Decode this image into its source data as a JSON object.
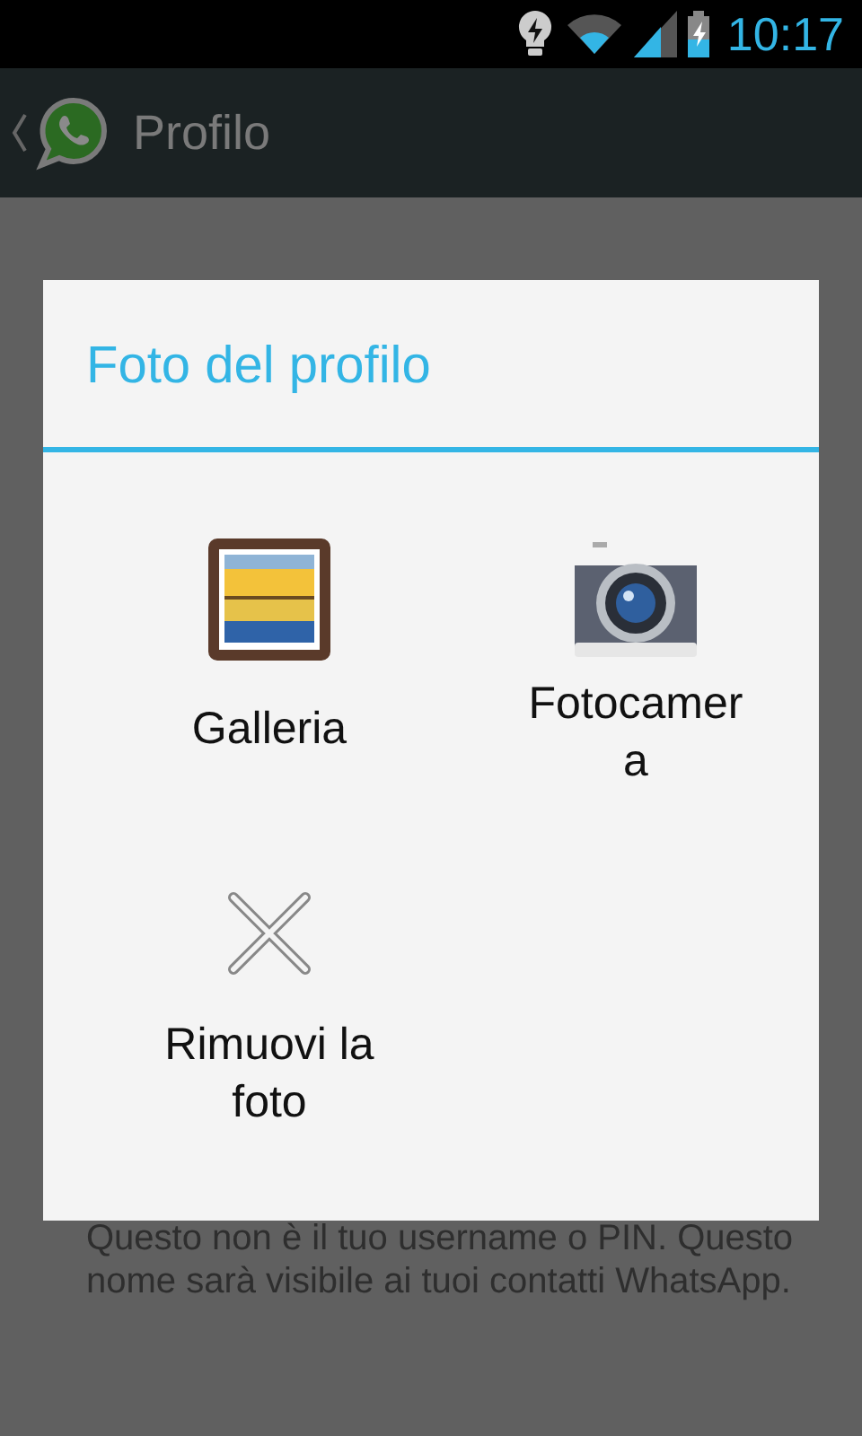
{
  "status_bar": {
    "time": "10:17"
  },
  "action_bar": {
    "title": "Profilo"
  },
  "background": {
    "help_text": "Questo non è il tuo username o PIN. Questo nome sarà visibile ai tuoi contatti WhatsApp."
  },
  "dialog": {
    "title": "Foto del profilo",
    "options": [
      {
        "kind": "gallery",
        "label": "Galleria"
      },
      {
        "kind": "camera",
        "label": "Fotocamera"
      },
      {
        "kind": "remove",
        "label": "Rimuovi la foto"
      }
    ]
  }
}
